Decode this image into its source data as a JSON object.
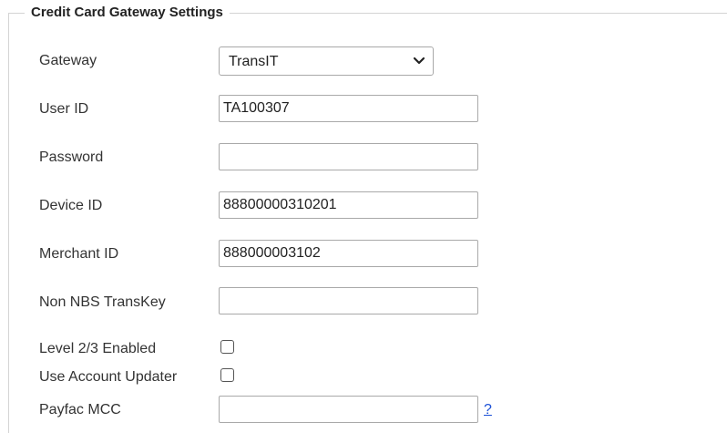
{
  "section": {
    "legend": "Credit Card Gateway Settings"
  },
  "fields": {
    "gateway": {
      "label": "Gateway",
      "selected": "TransIT"
    },
    "user_id": {
      "label": "User ID",
      "value": "TA100307"
    },
    "password": {
      "label": "Password",
      "value": ""
    },
    "device_id": {
      "label": "Device ID",
      "value": "88800000310201"
    },
    "merchant_id": {
      "label": "Merchant ID",
      "value": "888000003102"
    },
    "non_nbs_transkey": {
      "label": "Non NBS TransKey",
      "value": ""
    },
    "level_23_enabled": {
      "label": "Level 2/3 Enabled",
      "checked": false
    },
    "use_account_updater": {
      "label": "Use Account Updater",
      "checked": false
    },
    "payfac_mcc": {
      "label": "Payfac MCC",
      "value": "",
      "help_link": "?"
    }
  },
  "icons": {
    "select_chevron": "chevron-down-icon"
  },
  "colors": {
    "border": "#a9a9a9",
    "link": "#1a4fd6",
    "text": "#333333"
  }
}
